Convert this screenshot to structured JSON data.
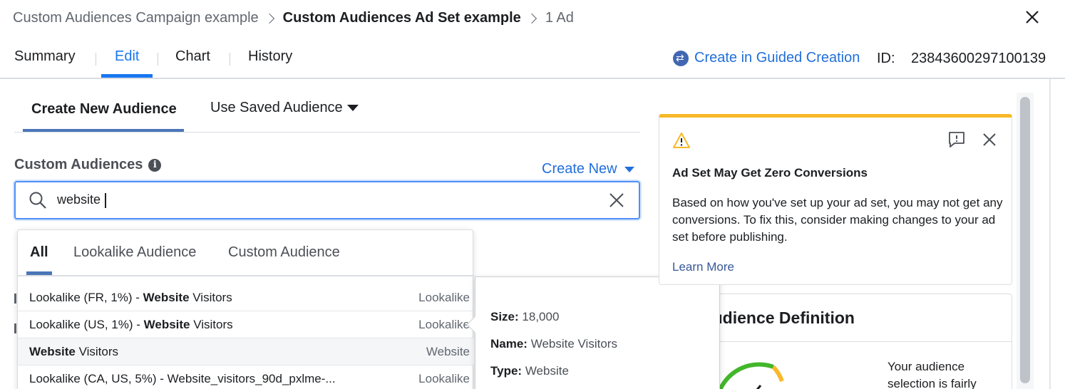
{
  "breadcrumb": {
    "campaign": "Custom Audiences Campaign example",
    "adset": "Custom Audiences Ad Set example",
    "ad": "1 Ad"
  },
  "tabs": {
    "summary": "Summary",
    "edit": "Edit",
    "chart": "Chart",
    "history": "History"
  },
  "header": {
    "guided_creation": "Create in Guided Creation",
    "id_label": "ID:",
    "id_value": "23843600297100139"
  },
  "audience_tabs": {
    "create_new": "Create New Audience",
    "use_saved": "Use Saved Audience"
  },
  "custom_audiences": {
    "label": "Custom Audiences",
    "create_new": "Create New",
    "search_value": "website"
  },
  "dropdown": {
    "tabs": [
      "All",
      "Lookalike Audience",
      "Custom Audience"
    ],
    "rows": [
      {
        "prefix": "Lookalike (FR, 1%) - ",
        "bold": "Website",
        "suffix": " Visitors",
        "type": "Lookalike"
      },
      {
        "prefix": "Lookalike (US, 1%) - ",
        "bold": "Website",
        "suffix": " Visitors",
        "type": "Lookalike"
      },
      {
        "prefix": "",
        "bold": "Website",
        "suffix": " Visitors",
        "type": "Website"
      },
      {
        "prefix": "Lookalike (CA, US, 5%) - Website_visitors_90d_pxlme-...",
        "bold": "",
        "suffix": "",
        "type": "Lookalike"
      }
    ]
  },
  "tooltip": {
    "size_label": "Size:",
    "size_value": "18,000",
    "name_label": "Name:",
    "name_value": "Website Visitors",
    "type_label": "Type:",
    "type_value": "Website"
  },
  "warning": {
    "title": "Ad Set May Get Zero Conversions",
    "body": "Based on how you've set up your ad set, you may not get any conversions. To fix this, consider making changes to your ad set before publishing.",
    "learn_more": "Learn More"
  },
  "definition": {
    "title": "Audience Definition",
    "text": "Your audience selection is fairly"
  },
  "colors": {
    "accent": "#1877f2",
    "link": "#216fdb",
    "warning": "#f7b928"
  }
}
